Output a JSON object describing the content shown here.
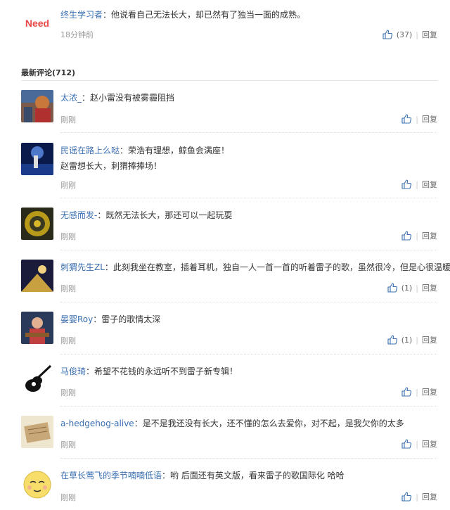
{
  "top_comment": {
    "logo_text": "Need",
    "user": "终生学习者",
    "content": "他说看自己无法长大，却已然有了独当一面的成熟。",
    "time": "18分钟前",
    "likes": "(37)",
    "reply_label": "回复"
  },
  "section": {
    "title": "最新评论(712)"
  },
  "comments": [
    {
      "user": "太浓_",
      "lines": [
        "赵小雷没有被雾霾阻挡"
      ],
      "time": "刚刚",
      "likes": "",
      "reply_label": "回复"
    },
    {
      "user": "民谣在路上么哒",
      "lines": [
        "荣浩有理想，鲸鱼会满座！",
        "赵雷想长大，刺猬捧捧场！"
      ],
      "time": "刚刚",
      "likes": "",
      "reply_label": "回复"
    },
    {
      "user": "无感而发-",
      "lines": [
        "既然无法长大，那还可以一起玩耍"
      ],
      "time": "刚刚",
      "likes": "",
      "reply_label": "回复"
    },
    {
      "user": "刺猬先生ZL",
      "lines": [
        "此刻我坐在教室，插着耳机，独自一人一首一首的听着雷子的歌，虽然很冷，但是心很温暖"
      ],
      "time": "刚刚",
      "likes": "(1)",
      "reply_label": "回复"
    },
    {
      "user": "晏婴Roy",
      "lines": [
        "雷子的歌情太深"
      ],
      "time": "刚刚",
      "likes": "(1)",
      "reply_label": "回复"
    },
    {
      "user": "马俊琦",
      "lines": [
        "希望不花钱的永远听不到雷子新专辑！"
      ],
      "time": "刚刚",
      "likes": "",
      "reply_label": "回复"
    },
    {
      "user": "a-hedgehog-alive",
      "lines": [
        "是不是我还没有长大，还不懂的怎么去爱你，对不起，是我欠你的太多"
      ],
      "time": "刚刚",
      "likes": "",
      "reply_label": "回复"
    },
    {
      "user": "在草长莺飞的季节喃喃低语",
      "lines": [
        "哟 后面还有英文版，看来雷子的歌国际化 哈哈"
      ],
      "time": "刚刚",
      "likes": "",
      "reply_label": "回复"
    }
  ],
  "colors": {
    "username": "#3a6fb2",
    "accent_logo": "#e84a4a",
    "meta": "#999999"
  }
}
